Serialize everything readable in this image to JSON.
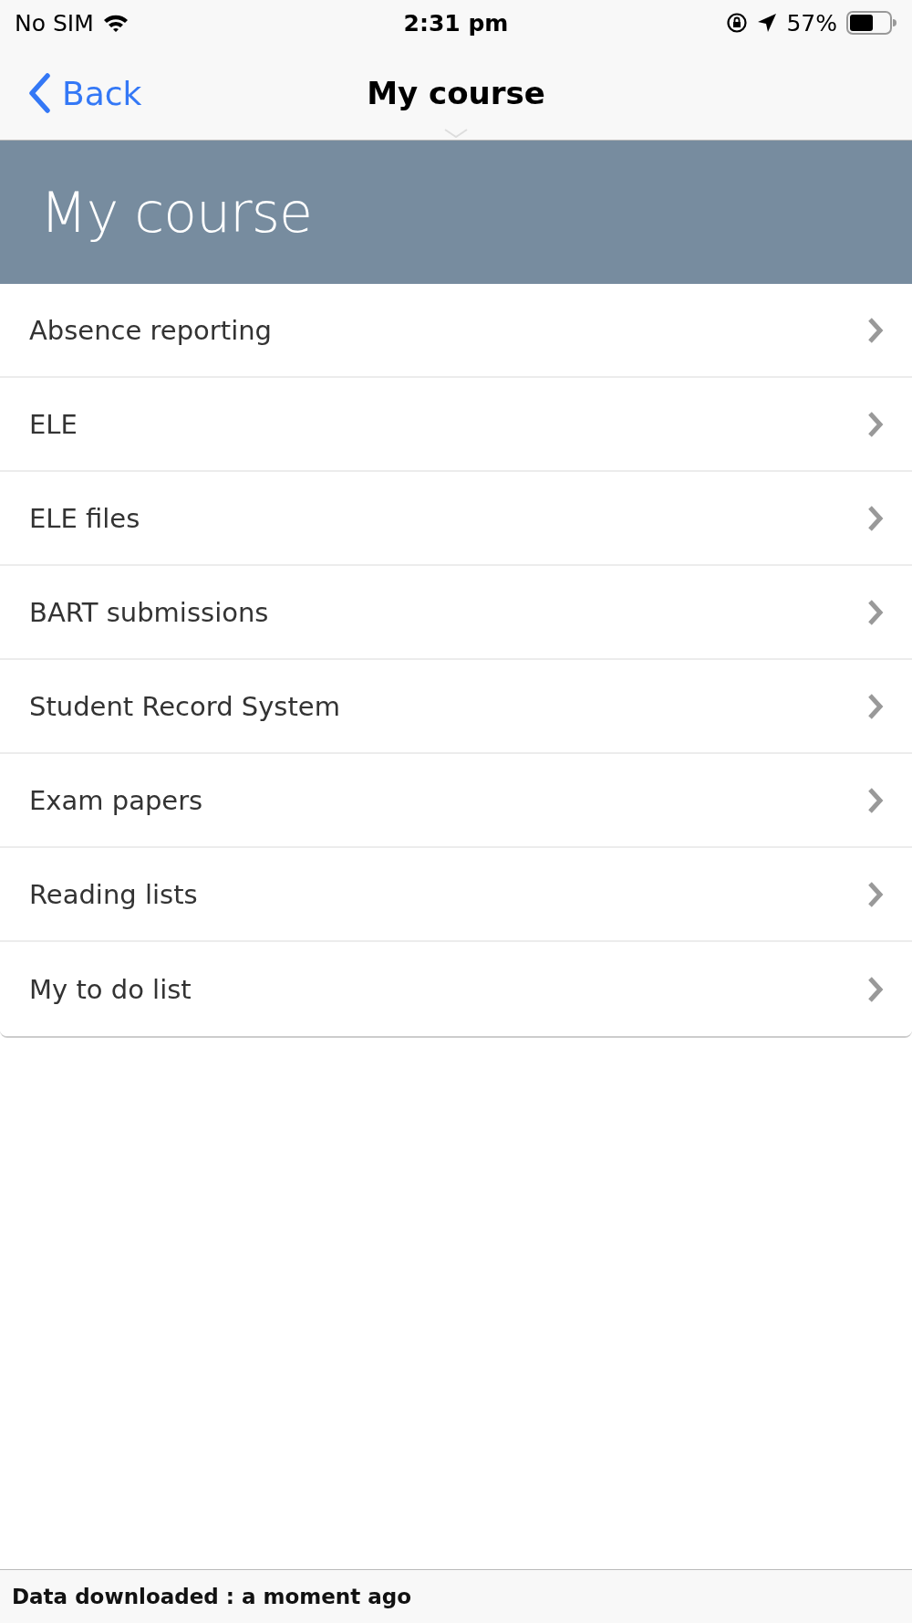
{
  "status_bar": {
    "carrier": "No SIM",
    "time": "2:31 pm",
    "battery": "57%"
  },
  "nav_bar": {
    "back": "Back",
    "title": "My course"
  },
  "header": {
    "title": "My course"
  },
  "menu": [
    {
      "label": "Absence reporting"
    },
    {
      "label": "ELE"
    },
    {
      "label": "ELE files"
    },
    {
      "label": "BART submissions"
    },
    {
      "label": "Student Record System"
    },
    {
      "label": "Exam papers"
    },
    {
      "label": "Reading lists"
    },
    {
      "label": "My to do list"
    }
  ],
  "footer": {
    "text": "Data downloaded : a moment ago"
  }
}
